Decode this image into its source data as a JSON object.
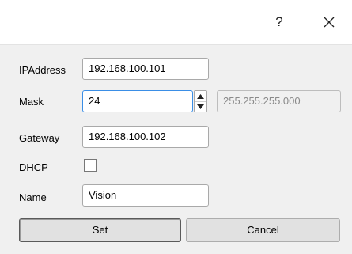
{
  "titlebar": {
    "help_icon": "question-mark-icon",
    "help_label": "?",
    "close_icon": "close-icon"
  },
  "form": {
    "ipaddress": {
      "label": "IPAddress",
      "value": "192.168.100.101"
    },
    "mask": {
      "label": "Mask",
      "value": "24",
      "computed": "255.255.255.000"
    },
    "gateway": {
      "label": "Gateway",
      "value": "192.168.100.102"
    },
    "dhcp": {
      "label": "DHCP",
      "checked": false
    },
    "name": {
      "label": "Name",
      "value": "Vision"
    }
  },
  "buttons": {
    "set_label": "Set",
    "cancel_label": "Cancel"
  },
  "colors": {
    "titlebar_bg": "#ffffff",
    "dialog_bg": "#f0f0f0",
    "focus_border": "#3a8ee6"
  }
}
